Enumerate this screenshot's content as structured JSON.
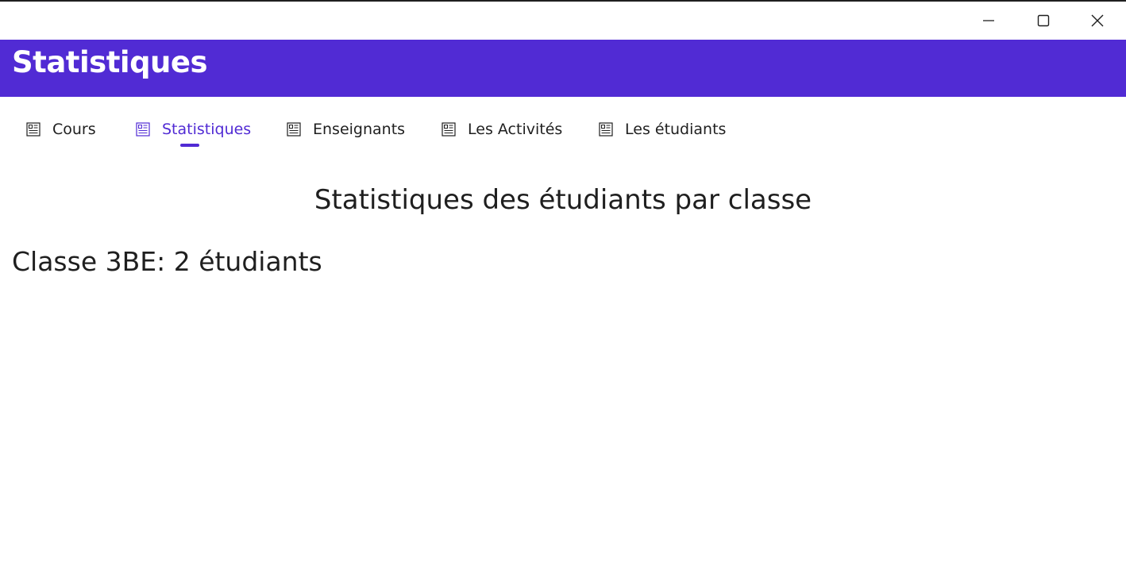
{
  "window": {
    "minimize_icon": "minimize-icon",
    "maximize_icon": "maximize-icon",
    "close_icon": "close-icon"
  },
  "header": {
    "title": "Statistiques",
    "background_color": "#512bd4"
  },
  "tabs": [
    {
      "label": "Cours",
      "icon": "document-icon",
      "active": false
    },
    {
      "label": "Statistiques",
      "icon": "document-icon",
      "active": true
    },
    {
      "label": "Enseignants",
      "icon": "document-icon",
      "active": false
    },
    {
      "label": "Les Activités",
      "icon": "document-icon",
      "active": false
    },
    {
      "label": "Les étudiants",
      "icon": "document-icon",
      "active": false
    }
  ],
  "main": {
    "heading": "Statistiques des étudiants par classe",
    "class_stats": [
      {
        "text": "Classe 3BE: 2 étudiants"
      }
    ]
  },
  "colors": {
    "accent": "#512bd4",
    "text": "#1f1f1f"
  }
}
